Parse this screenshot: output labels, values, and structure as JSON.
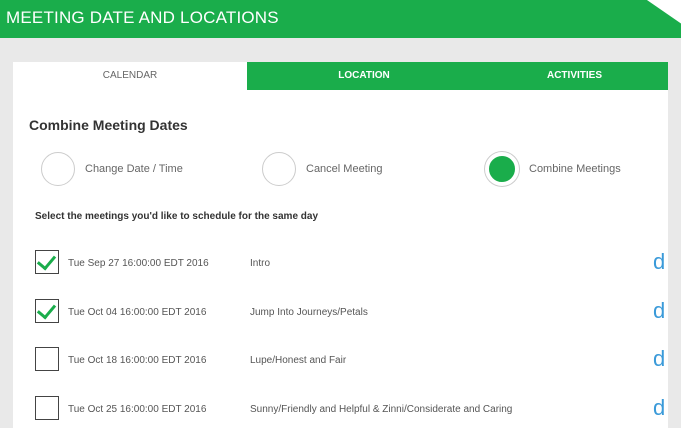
{
  "header": {
    "title": "MEETING DATE AND LOCATIONS"
  },
  "tabs": [
    {
      "label": "CALENDAR"
    },
    {
      "label": "LOCATION"
    },
    {
      "label": "ACTIVITIES"
    }
  ],
  "section": {
    "title": "Combine Meeting Dates",
    "instruction": "Select the meetings you'd like to schedule for the same day"
  },
  "options": [
    {
      "label": "Change Date / Time",
      "selected": false
    },
    {
      "label": "Cancel Meeting",
      "selected": false
    },
    {
      "label": "Combine Meetings",
      "selected": true
    }
  ],
  "meetings": [
    {
      "date": "Tue Sep 27 16:00:00 EDT 2016",
      "name": "Intro",
      "checked": true,
      "action": "d"
    },
    {
      "date": "Tue Oct 04 16:00:00 EDT 2016",
      "name": "Jump Into Journeys/Petals",
      "checked": true,
      "action": "d"
    },
    {
      "date": "Tue Oct 18 16:00:00 EDT 2016",
      "name": "Lupe/Honest and Fair",
      "checked": false,
      "action": "d"
    },
    {
      "date": "Tue Oct 25 16:00:00 EDT 2016",
      "name": "Sunny/Friendly and Helpful & Zinni/Considerate and Caring",
      "checked": false,
      "action": "d"
    }
  ],
  "colors": {
    "brand_green": "#1aad4b",
    "link_blue": "#3a9ad9"
  }
}
